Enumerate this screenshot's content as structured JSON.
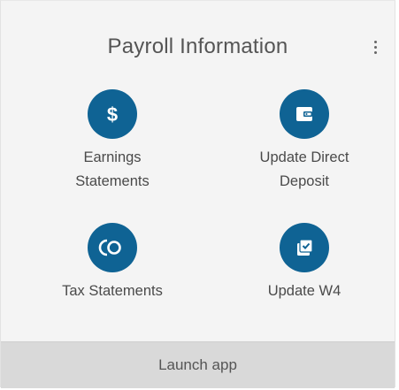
{
  "card": {
    "title": "Payroll Information",
    "menu_icon": "kebab-vertical-icon",
    "accent_color": "#0f6394",
    "tiles": [
      {
        "label_line1": "Earnings",
        "label_line2": "Statements",
        "icon": "dollar-icon"
      },
      {
        "label_line1": "Update Direct",
        "label_line2": "Deposit",
        "icon": "wallet-icon"
      },
      {
        "label_line1": "Tax Statements",
        "icon": "tax-icon"
      },
      {
        "label_line1": "Update W4",
        "icon": "document-check-icon"
      }
    ],
    "footer_label": "Launch app"
  }
}
